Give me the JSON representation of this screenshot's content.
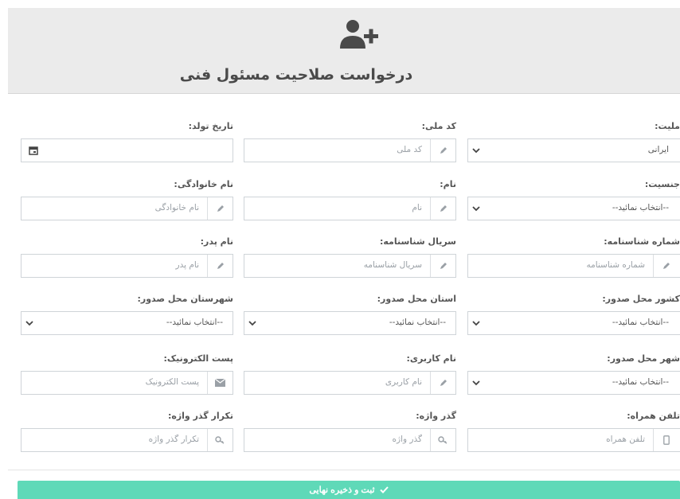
{
  "header": {
    "title": "درخواست صلاحیت مسئول فنی",
    "icon": "add-user-icon"
  },
  "fields": {
    "nationality": {
      "label": "ملیت:",
      "value": "ایرانی"
    },
    "national_code": {
      "label": "کد ملی:",
      "placeholder": "کد ملی"
    },
    "birth_date": {
      "label": "تاریخ تولد:",
      "placeholder": ""
    },
    "gender": {
      "label": "جنسیت:",
      "value": "--انتخاب نمائید--"
    },
    "first_name": {
      "label": "نام:",
      "placeholder": "نام"
    },
    "last_name": {
      "label": "نام خانوادگی:",
      "placeholder": "نام خانوادگی"
    },
    "id_number": {
      "label": "شماره شناسنامه:",
      "placeholder": "شماره شناسنامه"
    },
    "id_serial": {
      "label": "سریال شناسنامه:",
      "placeholder": "سریال شناسنامه"
    },
    "father_name": {
      "label": "نام پدر:",
      "placeholder": "نام پدر"
    },
    "issue_country": {
      "label": "کشور محل صدور:",
      "value": "--انتخاب نمائید--"
    },
    "issue_province": {
      "label": "استان محل صدور:",
      "value": "--انتخاب نمائید--"
    },
    "issue_county": {
      "label": "شهرستان محل صدور:",
      "value": "--انتخاب نمائید--"
    },
    "issue_city": {
      "label": "شهر محل صدور:",
      "value": "--انتخاب نمائید--"
    },
    "username": {
      "label": "نام کاربری:",
      "placeholder": "نام کاربری"
    },
    "email": {
      "label": "پست الکترونیک:",
      "placeholder": "پست الکترونیک"
    },
    "mobile": {
      "label": "تلفن همراه:",
      "placeholder": "تلفن همراه"
    },
    "password": {
      "label": "گذر واژه:",
      "placeholder": "گذر واژه"
    },
    "password_repeat": {
      "label": "تکرار گذر واژه:",
      "placeholder": "تکرار گذر واژه"
    }
  },
  "submit": {
    "label": "ثبت و ذخیره نهایی"
  },
  "colors": {
    "accent": "#5fd9b8",
    "header_bg": "#ebebeb",
    "icon": "#4a4a4a"
  }
}
